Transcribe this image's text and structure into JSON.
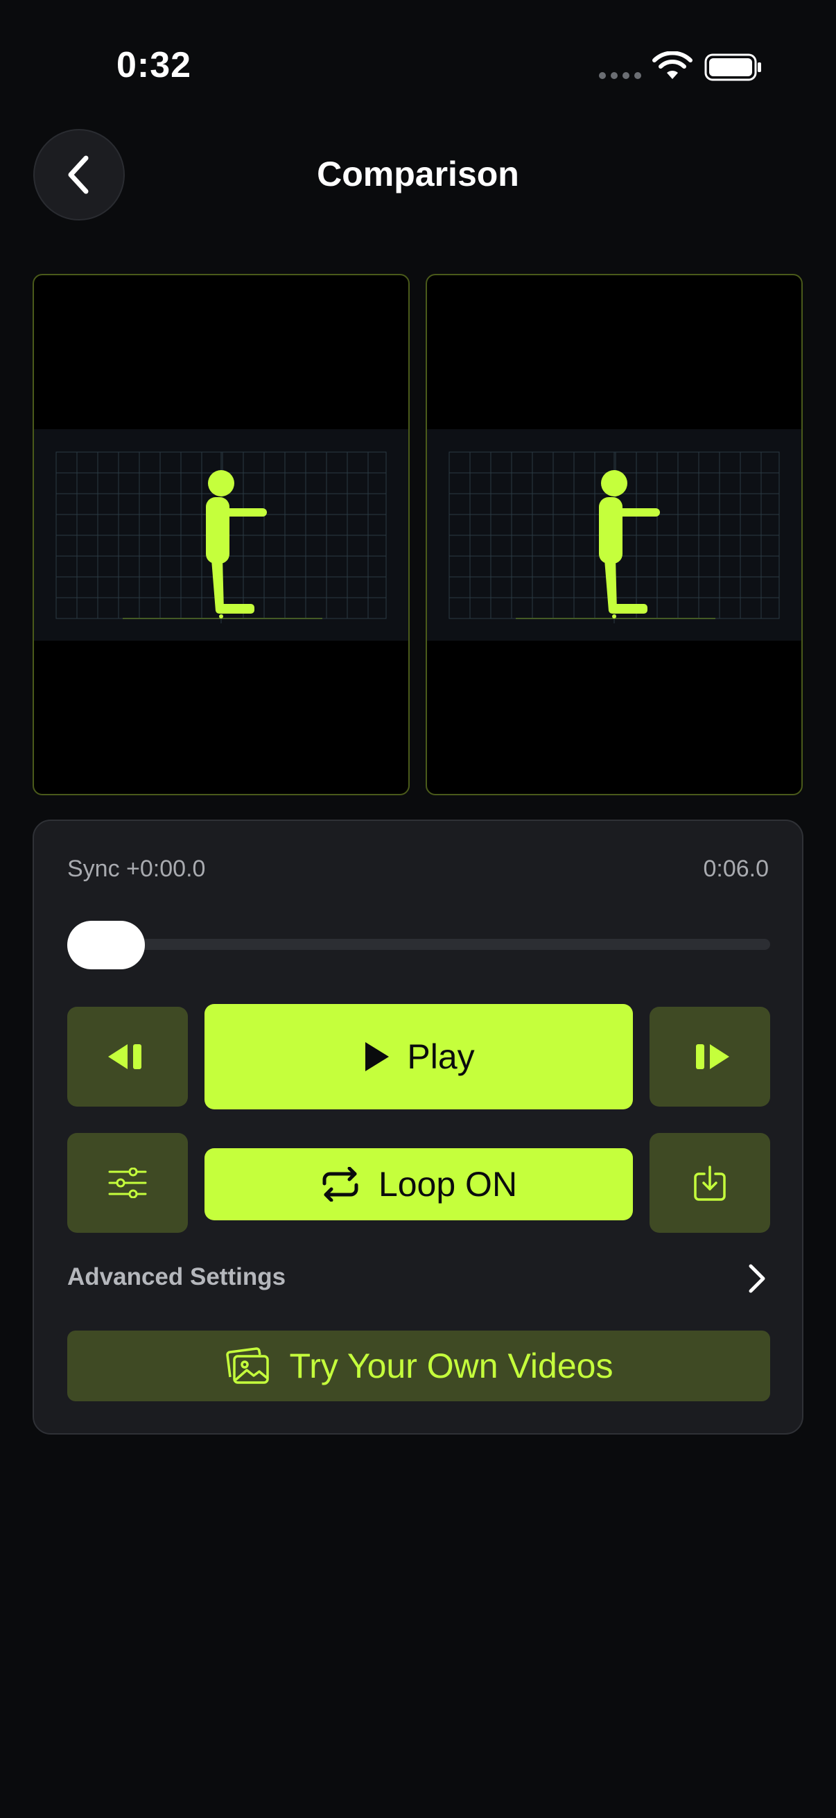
{
  "status_bar": {
    "time": "0:32"
  },
  "header": {
    "title": "Comparison",
    "back_icon": "chevron-left-icon"
  },
  "videos": [
    {
      "name": "left-video",
      "figure": "stick-figure"
    },
    {
      "name": "right-video",
      "figure": "stick-figure"
    }
  ],
  "controls": {
    "sync_label": "Sync +0:00.0",
    "duration": "0:06.0",
    "progress": 0.0,
    "play_label": "Play",
    "loop_label": "Loop ON",
    "advanced_label": "Advanced Settings",
    "try_label": "Try Your Own Videos"
  },
  "colors": {
    "accent": "#c5ff3c",
    "accent_dim": "#3f4a24",
    "background": "#0a0b0d",
    "card": "#1b1c20"
  }
}
